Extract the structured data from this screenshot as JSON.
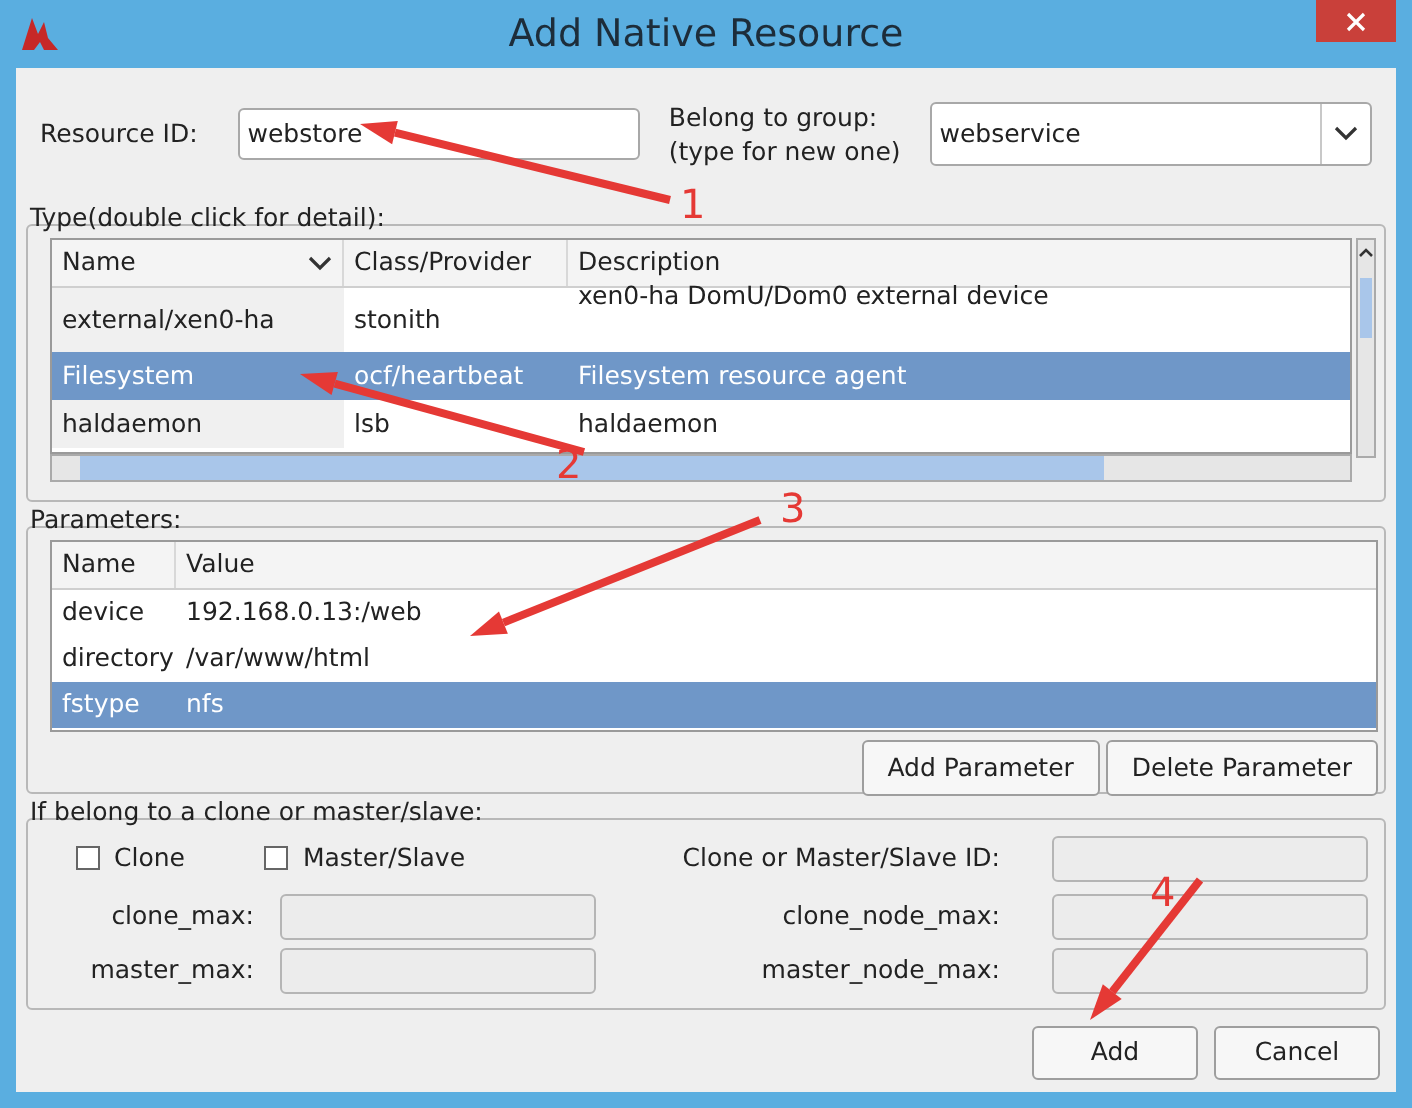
{
  "window": {
    "title": "Add Native Resource"
  },
  "resource_id": {
    "label": "Resource ID:",
    "value": "webstore"
  },
  "group": {
    "label_lines": [
      "Belong to group:",
      "(type for new one)"
    ],
    "value": "webservice"
  },
  "type_table": {
    "legend": "Type(double click for detail):",
    "columns": [
      "Name",
      "Class/Provider",
      "Description"
    ],
    "rows": [
      {
        "name": "external/xen0-ha",
        "provider": "stonith",
        "description": "xen0-ha DomU/Dom0 external device",
        "selected": false
      },
      {
        "name": "Filesystem",
        "provider": "ocf/heartbeat",
        "description": "Filesystem resource agent",
        "selected": true
      },
      {
        "name": "haldaemon",
        "provider": "lsb",
        "description": "haldaemon",
        "selected": false
      }
    ]
  },
  "parameters": {
    "legend": "Parameters:",
    "columns": [
      "Name",
      "Value"
    ],
    "rows": [
      {
        "name": "device",
        "value": "192.168.0.13:/web",
        "selected": false
      },
      {
        "name": "directory",
        "value": "/var/www/html",
        "selected": false
      },
      {
        "name": "fstype",
        "value": "nfs",
        "selected": true
      }
    ],
    "buttons": [
      "Add Parameter",
      "Delete Parameter"
    ]
  },
  "clone": {
    "legend": "If belong to a clone or master/slave:",
    "checkboxes": [
      {
        "label": "Clone",
        "checked": false
      },
      {
        "label": "Master/Slave",
        "checked": false
      }
    ],
    "id_label": "Clone or Master/Slave ID:",
    "left_fields": [
      "clone_max:",
      "master_max:"
    ],
    "right_fields": [
      "clone_node_max:",
      "master_node_max:"
    ]
  },
  "buttons": [
    "Add",
    "Cancel"
  ],
  "annotations": [
    "1",
    "2",
    "3",
    "4"
  ]
}
